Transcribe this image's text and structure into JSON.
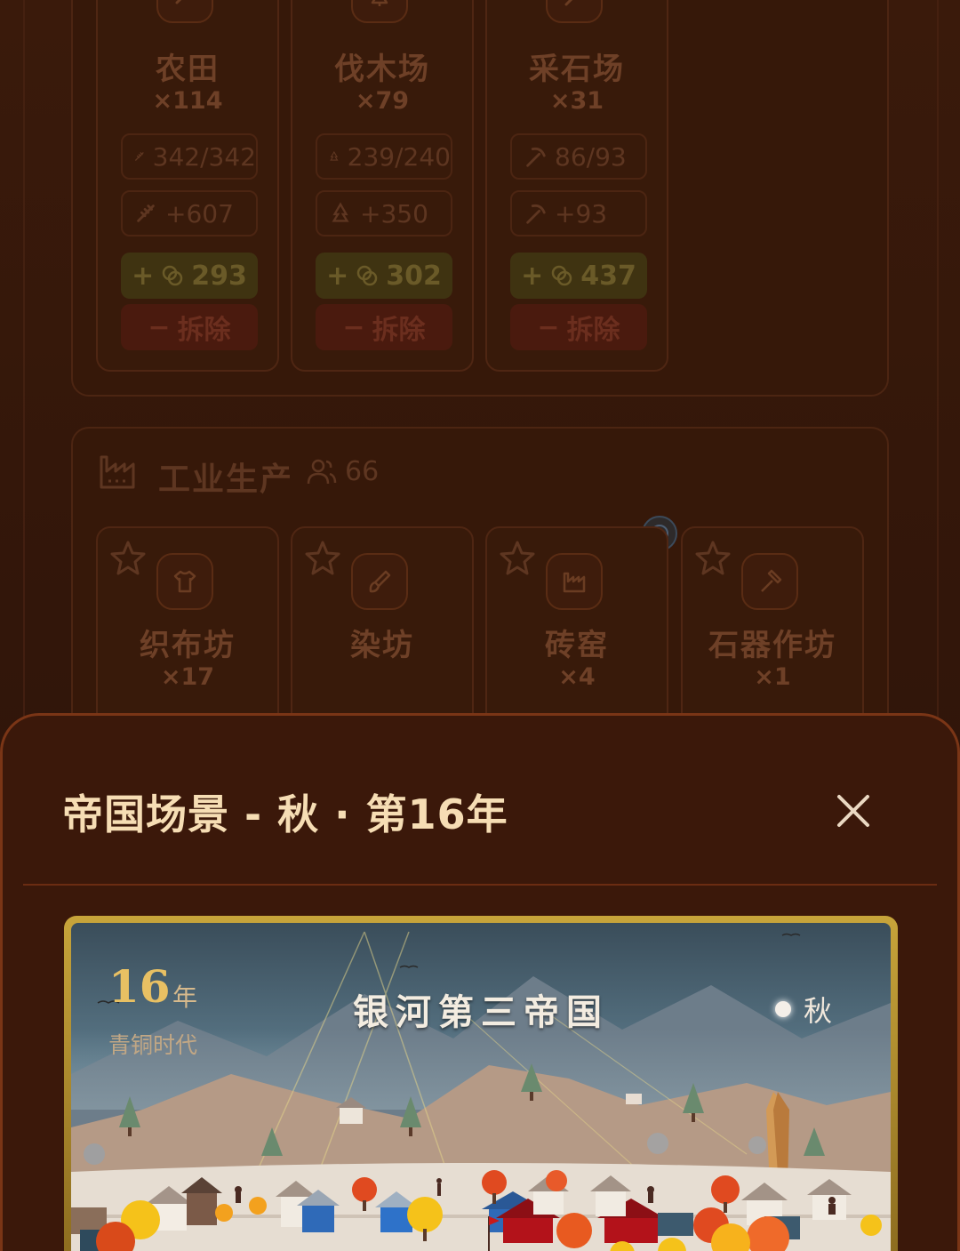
{
  "colors": {
    "accent_gold": "#e8c063",
    "sheet_title": "#f6ddb4",
    "build_green": "#3f3311",
    "demolish_red": "#4a1a0e"
  },
  "primary_buildings": [
    {
      "name": "农田",
      "count": "×114",
      "icon": "wheat-icon",
      "capacity": "342/342",
      "production": "+607",
      "build_cost": "293",
      "demolish_label": "拆除"
    },
    {
      "name": "伐木场",
      "count": "×79",
      "icon": "tree-icon",
      "capacity": "239/240",
      "production": "+350",
      "build_cost": "302",
      "demolish_label": "拆除"
    },
    {
      "name": "采石场",
      "count": "×31",
      "icon": "pickaxe-icon",
      "capacity": "86/93",
      "production": "+93",
      "build_cost": "437",
      "demolish_label": "拆除"
    }
  ],
  "industry_section": {
    "title": "工业生产",
    "workers": "66",
    "buildings": [
      {
        "name": "织布坊",
        "count": "×17",
        "icon": "shirt-icon"
      },
      {
        "name": "染坊",
        "count": "",
        "icon": "brush-icon"
      },
      {
        "name": "砖窑",
        "count": "×4",
        "icon": "factory-icon"
      },
      {
        "name": "石器作坊",
        "count": "×1",
        "icon": "hammer-icon"
      }
    ]
  },
  "modal": {
    "title": "帝国场景 - 秋 · 第16年",
    "close_icon": "close-icon"
  },
  "scene": {
    "year": "16",
    "year_unit": "年",
    "era": "青铜时代",
    "empire_name": "银河第三帝国",
    "season": "秋"
  }
}
